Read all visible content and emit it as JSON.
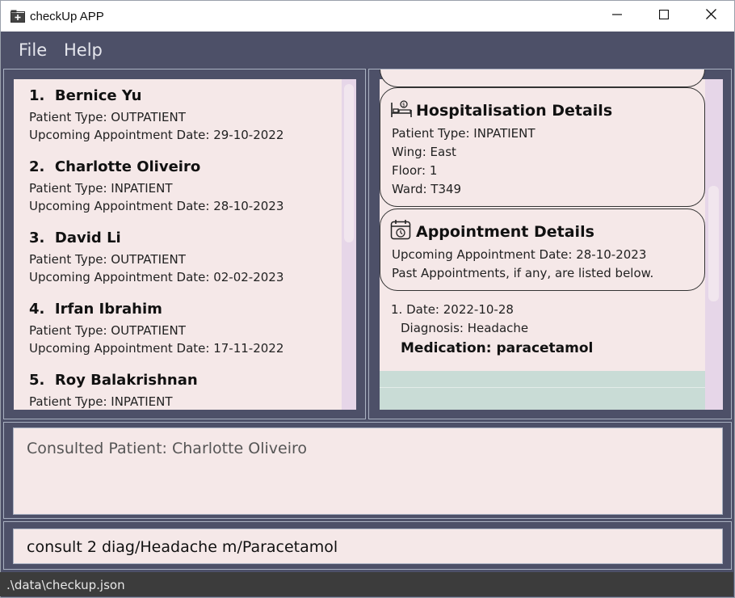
{
  "window": {
    "title": "checkUp APP"
  },
  "menu": {
    "file": "File",
    "help": "Help"
  },
  "patients": [
    {
      "index": "1.",
      "name": "Bernice Yu",
      "type": "Patient Type: OUTPATIENT",
      "appt": "Upcoming Appointment Date: 29-10-2022"
    },
    {
      "index": "2.",
      "name": "Charlotte Oliveiro",
      "type": "Patient Type: INPATIENT",
      "appt": "Upcoming Appointment Date: 28-10-2023"
    },
    {
      "index": "3.",
      "name": "David Li",
      "type": "Patient Type: OUTPATIENT",
      "appt": "Upcoming Appointment Date: 02-02-2023"
    },
    {
      "index": "4.",
      "name": "Irfan Ibrahim",
      "type": "Patient Type: OUTPATIENT",
      "appt": "Upcoming Appointment Date: 17-11-2022"
    },
    {
      "index": "5.",
      "name": "Roy Balakrishnan",
      "type": "Patient Type: INPATIENT",
      "appt": ""
    }
  ],
  "details": {
    "hospitalisation": {
      "title": "Hospitalisation Details",
      "type": "Patient Type: INPATIENT",
      "wing": "Wing: East",
      "floor": "Floor: 1",
      "ward": "Ward: T349"
    },
    "appointment": {
      "title": "Appointment Details",
      "upcoming": "Upcoming Appointment Date: 28-10-2023",
      "past_note": "Past Appointments, if any, are listed below."
    },
    "past": {
      "date": "1. Date: 2022-10-28",
      "diagnosis": "Diagnosis: Headache",
      "medication": "Medication: paracetamol"
    }
  },
  "result": {
    "text": "Consulted Patient: Charlotte Oliveiro"
  },
  "command": {
    "text": "consult 2 diag/Headache m/Paracetamol"
  },
  "status": {
    "path": ".\\data\\checkup.json"
  },
  "icons": {
    "app": "folder-plus-icon",
    "hospital": "hospital-bed-icon",
    "calendar": "calendar-icon"
  }
}
